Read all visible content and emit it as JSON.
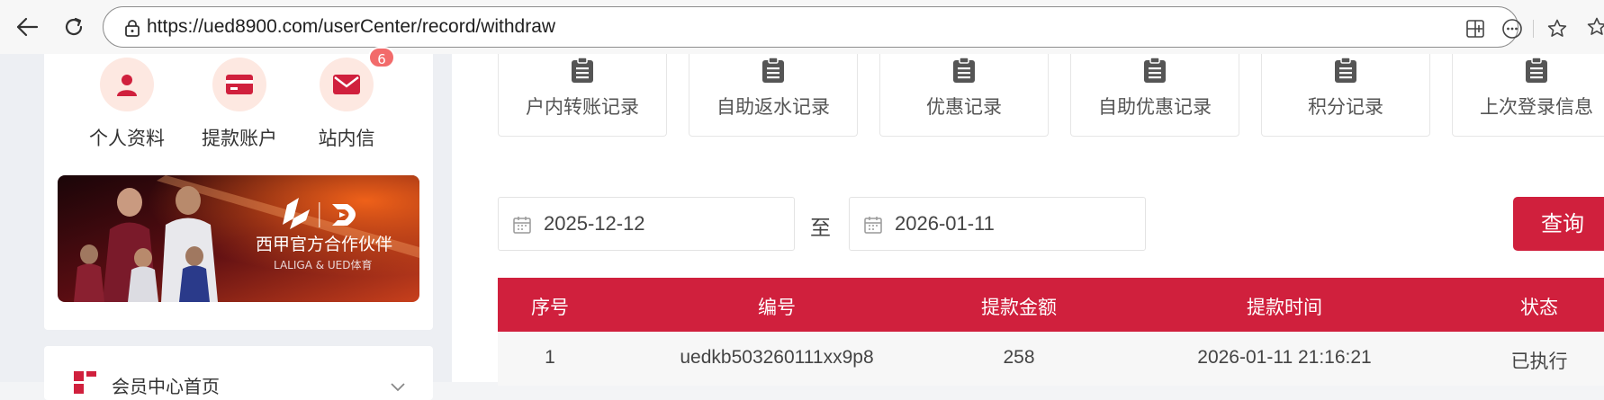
{
  "browser": {
    "url": "https://ued8900.com/userCenter/record/withdraw"
  },
  "profile": {
    "items": [
      {
        "label": "个人资料",
        "icon": "user-icon"
      },
      {
        "label": "提款账户",
        "icon": "card-icon"
      },
      {
        "label": "站内信",
        "icon": "mail-icon"
      }
    ],
    "mail_badge": "6"
  },
  "banner": {
    "title": "西甲官方合作伙伴",
    "subtitle": "LALIGA & UED体育"
  },
  "menu": {
    "home_label": "会员中心首页"
  },
  "record_tabs": [
    {
      "label": "户内转账记录"
    },
    {
      "label": "自助返水记录"
    },
    {
      "label": "优惠记录"
    },
    {
      "label": "自助优惠记录"
    },
    {
      "label": "积分记录"
    },
    {
      "label": "上次登录信息"
    }
  ],
  "filter": {
    "start_date": "2025-12-12",
    "to_label": "至",
    "end_date": "2026-01-11",
    "query_label": "查询"
  },
  "table": {
    "headers": [
      "序号",
      "编号",
      "提款金额",
      "提款时间",
      "状态"
    ],
    "rows": [
      [
        "1",
        "uedkb503260111xx9p8",
        "258",
        "2026-01-11 21:16:21",
        "已执行"
      ]
    ]
  },
  "colors": {
    "brand_red": "#d0203d",
    "icon_pink_bg": "#fde8e1",
    "badge_red": "#f26b6b"
  }
}
